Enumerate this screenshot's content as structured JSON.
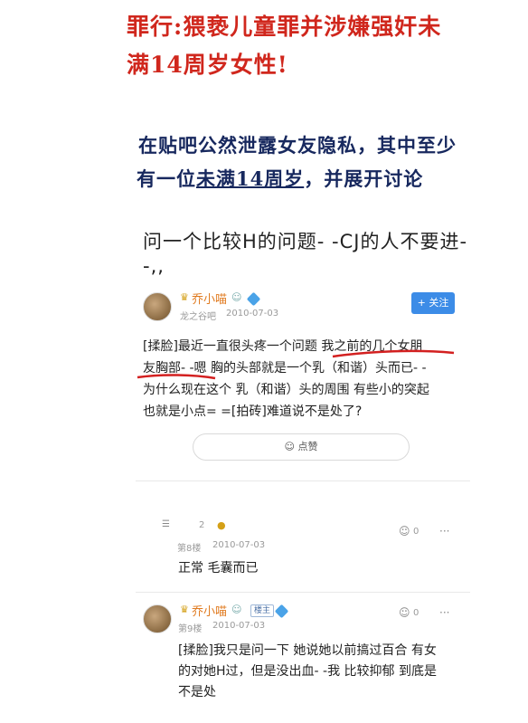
{
  "headline": {
    "line1": "罪行:猥亵儿童罪并涉嫌强奸未",
    "line2": "满14周岁女性!"
  },
  "subheadline": {
    "line1": "在贴吧公然泄露女友隐私，其中至少",
    "line2_a": "有一位",
    "line2_b": "未满14周岁",
    "line2_c": "，并展开讨论"
  },
  "post": {
    "title_line1": "问一个比较H的问题- -CJ的人不要进-",
    "title_line2": "-,,",
    "author": "乔小喵",
    "forum": "龙之谷吧",
    "date": "2010-07-03",
    "follow_label": "+ 关注",
    "body_lines": [
      "[揉脸]最近一直很头疼一个问题 我之前的几个女朋",
      "友胸部- -嗯 胸的头部就是一个乳（和谐）头而已- -",
      "为什么现在这个 乳（和谐）头的周围 有些小的突起",
      "也就是小点= =[拍砖]难道说不是处了?"
    ],
    "like_label": "点赞"
  },
  "reply1": {
    "level": "2",
    "floor": "第8楼",
    "date": "2010-07-03",
    "like_count": "0",
    "more": "···",
    "text": "正常 毛囊而已"
  },
  "reply2": {
    "author": "乔小喵",
    "badge": "楼主",
    "floor": "第9楼",
    "date": "2010-07-03",
    "like_count": "0",
    "more": "···",
    "body_lines": [
      "[揉脸]我只是问一下 她说她以前搞过百合 有女",
      "的对她H过，但是没出血- -我 比较抑郁 到底是",
      "不是处"
    ]
  },
  "colors": {
    "headline_red": "#d0271d",
    "sub_blue": "#17285e",
    "username_orange": "#e07a1f",
    "follow_blue": "#3c8ce7",
    "annotation_red": "#d32020"
  }
}
